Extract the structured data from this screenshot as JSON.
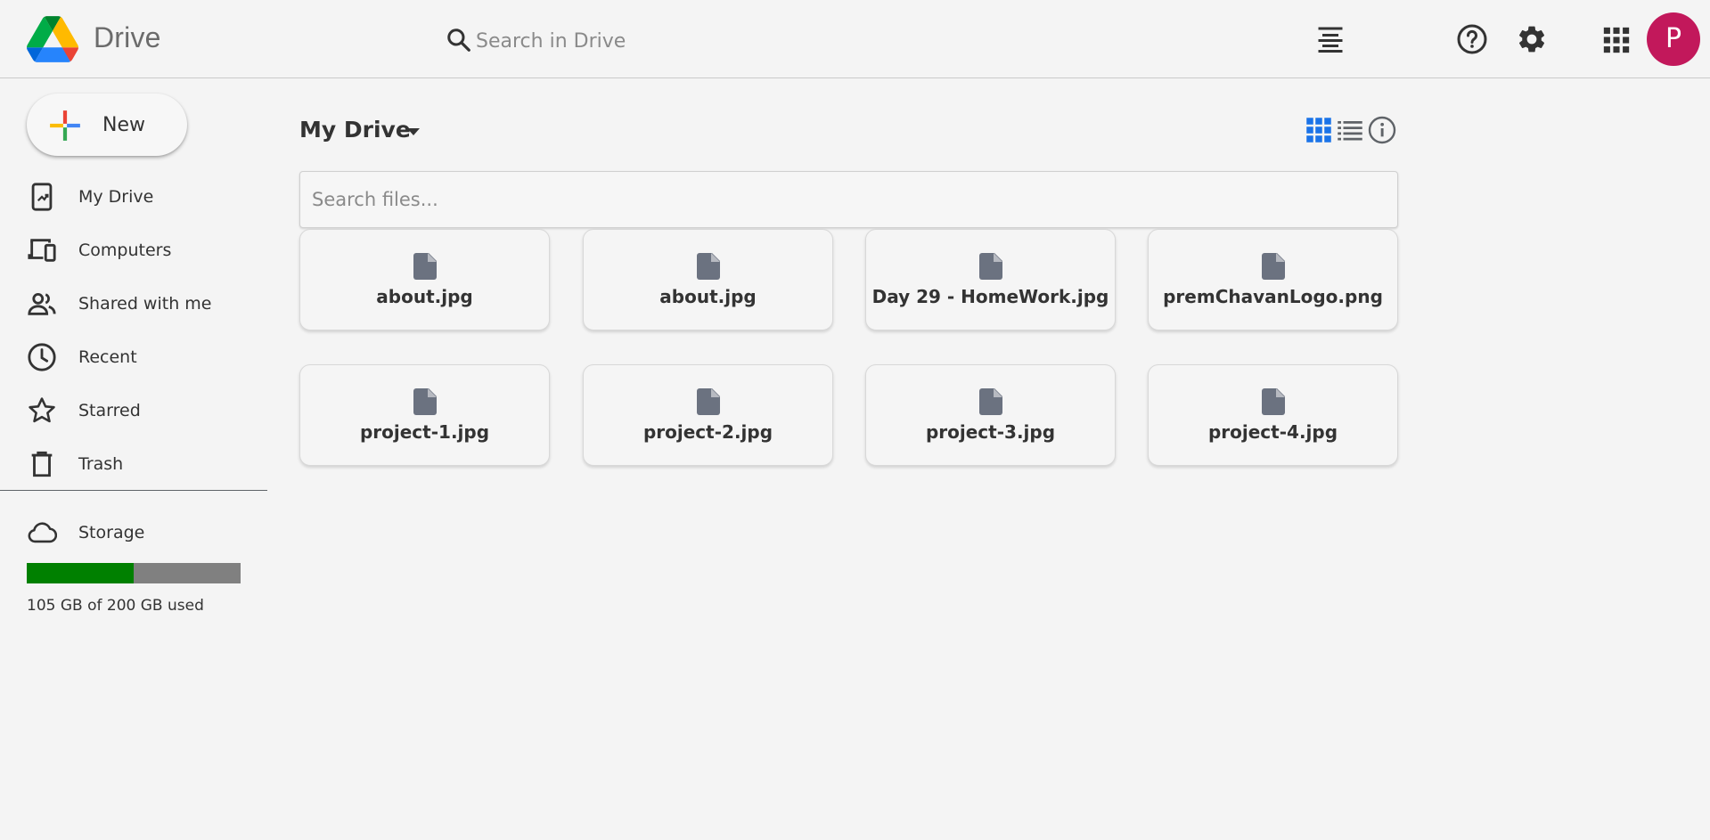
{
  "header": {
    "brand": "Drive",
    "search_placeholder": "Search in Drive",
    "avatar_initial": "P"
  },
  "sidebar": {
    "new_label": "New",
    "items": [
      {
        "label": "My Drive",
        "icon": "my-drive-icon"
      },
      {
        "label": "Computers",
        "icon": "computers-icon"
      },
      {
        "label": "Shared with me",
        "icon": "shared-icon"
      },
      {
        "label": "Recent",
        "icon": "clock-icon"
      },
      {
        "label": "Starred",
        "icon": "star-icon"
      },
      {
        "label": "Trash",
        "icon": "trash-icon"
      }
    ],
    "storage": {
      "label": "Storage",
      "used_fraction": 0.5,
      "usage_text": "105 GB of 200 GB used",
      "colors": {
        "used": "#008000",
        "free": "#808080"
      }
    }
  },
  "main": {
    "title": "My Drive",
    "file_search_placeholder": "Search files...",
    "files": [
      {
        "name": "about.jpg"
      },
      {
        "name": "about.jpg"
      },
      {
        "name": "Day 29 - HomeWork.jpg"
      },
      {
        "name": "premChavanLogo.png"
      },
      {
        "name": "project-1.jpg"
      },
      {
        "name": "project-2.jpg"
      },
      {
        "name": "project-3.jpg"
      },
      {
        "name": "project-4.jpg"
      }
    ]
  },
  "colors": {
    "avatar": "#c2185b",
    "grid_view_active": "#1a73e8",
    "file_icon": "#6b7280"
  }
}
